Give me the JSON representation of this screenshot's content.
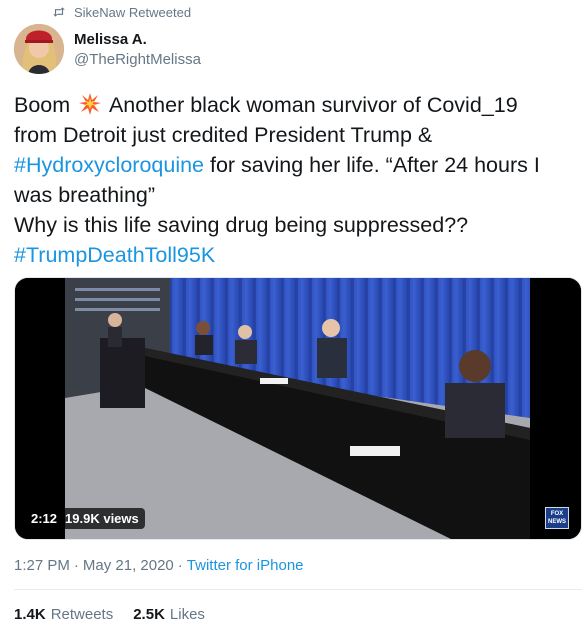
{
  "retweet_context": {
    "text": "SikeNaw Retweeted"
  },
  "author": {
    "display_name": "Melissa A.",
    "handle": "@TheRightMelissa"
  },
  "tweet": {
    "line1_a": "Boom",
    "line1_b": "Another black woman survivor of Covid_19",
    "line2": "from Detroit just credited President Trump &",
    "line3_hashtag": "#Hydroxycloroquine",
    "line3_rest": " for saving her life. “After 24 hours I",
    "line4": "was breathing”",
    "line5": "Why is this life saving drug being suppressed??",
    "line6_hashtag": "#TrumpDeathToll95K"
  },
  "media": {
    "duration": "2:12",
    "views": "19.9K views",
    "channel_logo_text": "FOX NEWS"
  },
  "meta": {
    "time": "1:27 PM",
    "separator1": "·",
    "date": "May 21, 2020",
    "separator2": "·",
    "source": "Twitter for iPhone"
  },
  "stats": {
    "retweets_count": "1.4K",
    "retweets_label": "Retweets",
    "likes_count": "2.5K",
    "likes_label": "Likes"
  },
  "colors": {
    "link": "#1b95e0",
    "secondary_text": "#657786",
    "text": "#14171a"
  },
  "icons": {
    "retweet": "retweet-icon",
    "emoji": "collision-emoji"
  }
}
